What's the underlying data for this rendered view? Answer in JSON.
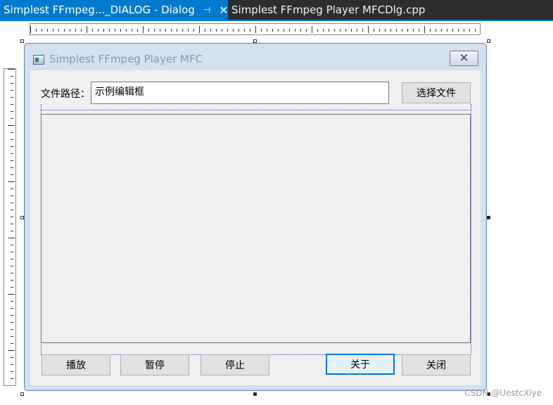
{
  "tabs": [
    {
      "label": "Simplest FFmpeg..._DIALOG - Dialog",
      "active": true
    },
    {
      "label": "Simplest FFmpeg Player MFCDlg.cpp",
      "active": false
    }
  ],
  "dialog": {
    "title": "Simplest FFmpeg Player MFC",
    "path_label": "文件路径：",
    "path_value": "示例编辑框",
    "browse_label": "选择文件",
    "buttons": {
      "play": "播放",
      "pause": "暂停",
      "stop": "停止",
      "about": "关于",
      "close": "关闭"
    }
  },
  "watermark": "CSDN @UestcXiye",
  "colors": {
    "tab_active": "#007acc",
    "tab_bar": "#2d2d30",
    "dialog_frame": "#d5e1ef",
    "client_bg": "#f0f0f0"
  }
}
